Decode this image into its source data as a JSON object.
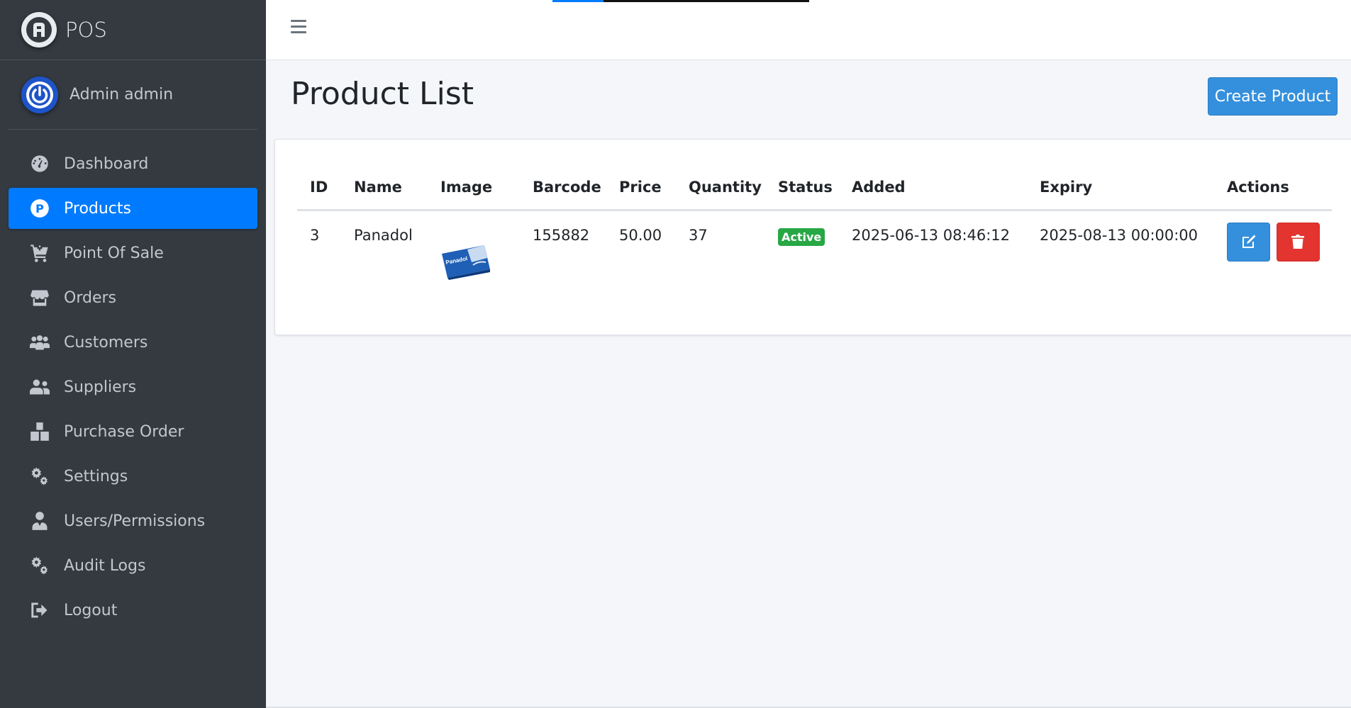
{
  "brand": {
    "name": "POS"
  },
  "user": {
    "name": "Admin admin"
  },
  "sidebar": {
    "items": [
      {
        "label": "Dashboard",
        "icon": "dashboard-icon"
      },
      {
        "label": "Products",
        "icon": "products-icon",
        "active": true
      },
      {
        "label": "Point Of Sale",
        "icon": "cart-plus-icon"
      },
      {
        "label": "Orders",
        "icon": "store-icon"
      },
      {
        "label": "Customers",
        "icon": "users-icon"
      },
      {
        "label": "Suppliers",
        "icon": "user-friends-icon"
      },
      {
        "label": "Purchase Order",
        "icon": "boxes-icon"
      },
      {
        "label": "Settings",
        "icon": "cogs-icon"
      },
      {
        "label": "Users/Permissions",
        "icon": "user-tie-icon"
      },
      {
        "label": "Audit Logs",
        "icon": "cogs-icon"
      },
      {
        "label": "Logout",
        "icon": "sign-out-icon"
      }
    ],
    "products_badge": "P"
  },
  "main": {
    "title": "Product List",
    "create_button": "Create Product"
  },
  "table": {
    "headers": [
      "ID",
      "Name",
      "Image",
      "Barcode",
      "Price",
      "Quantity",
      "Status",
      "Added",
      "Expiry",
      "Actions"
    ],
    "rows": [
      {
        "id": "3",
        "name": "Panadol",
        "image_text": "Panadol",
        "barcode": "155882",
        "price": "50.00",
        "quantity": "37",
        "status": "Active",
        "added": "2025-06-13 08:46:12",
        "expiry": "2025-08-13 00:00:00"
      }
    ]
  },
  "colors": {
    "sidebar_bg": "#343a40",
    "active_blue": "#007bff",
    "primary_button": "#3490dc",
    "danger_button": "#e3342f",
    "success_badge": "#28a745"
  }
}
